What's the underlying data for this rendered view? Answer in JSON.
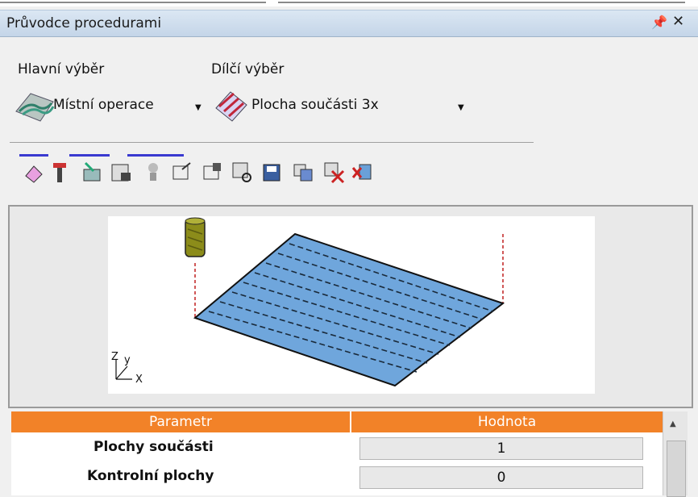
{
  "panel": {
    "title": "Průvodce procedurami"
  },
  "selection": {
    "main_label": "Hlavní výběr",
    "sub_label": "Dílčí výběr",
    "main_value": "Místní operace",
    "sub_value": "Plocha součásti 3x"
  },
  "toolbar": {
    "icons": [
      "pocket-icon",
      "tool-icon",
      "link-icon",
      "machine-icon",
      "lathe-icon",
      "export-icon",
      "import-icon",
      "params-icon",
      "save-icon",
      "copy-icon",
      "cut-icon",
      "close-icon"
    ]
  },
  "preview": {
    "axis_labels": {
      "z": "Z",
      "y": "y",
      "x": "X"
    }
  },
  "grid": {
    "headers": {
      "param": "Parametr",
      "value": "Hodnota"
    },
    "rows": [
      {
        "name": "Plochy součásti",
        "value": "1"
      },
      {
        "name": "Kontrolní plochy",
        "value": "0"
      }
    ]
  },
  "colors": {
    "accent": "#f28228",
    "surface": "#6fa6dc",
    "title_bar": "#c4d5e8"
  }
}
